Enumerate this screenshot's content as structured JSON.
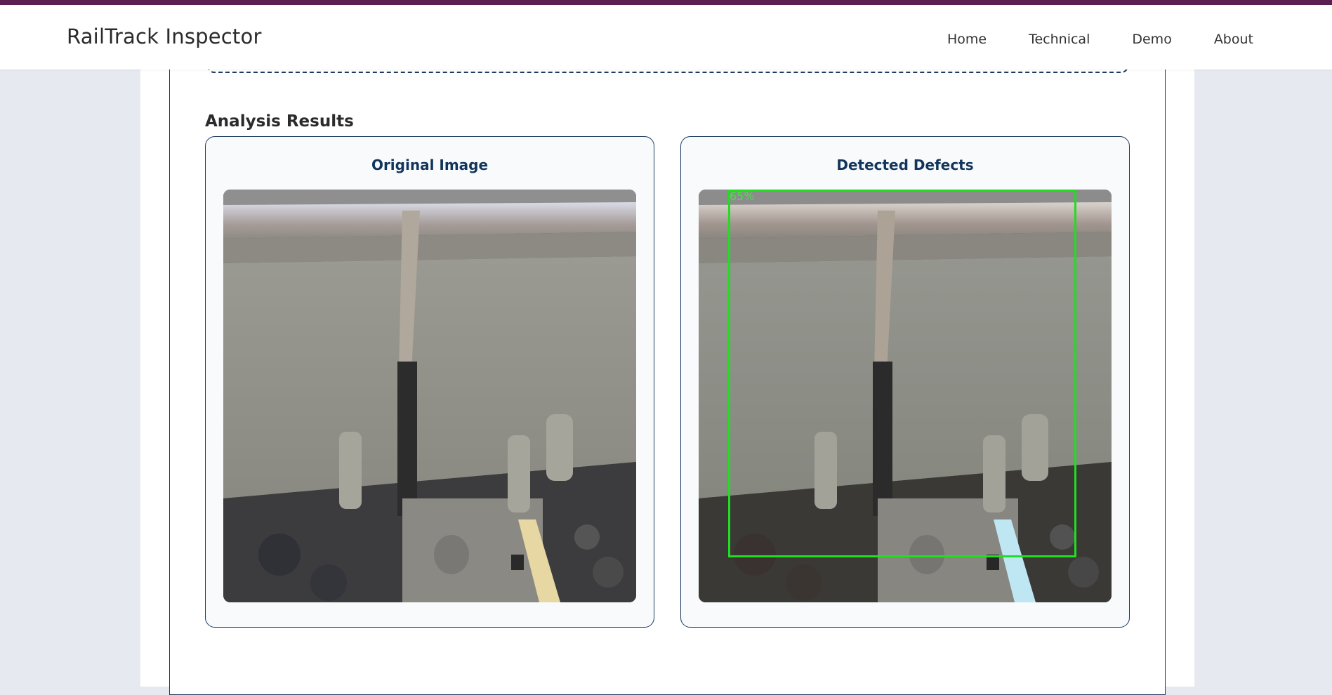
{
  "app": {
    "brand": "RailTrack Inspector"
  },
  "nav": {
    "items": [
      {
        "label": "Home"
      },
      {
        "label": "Technical"
      },
      {
        "label": "Demo"
      },
      {
        "label": "About"
      }
    ]
  },
  "results": {
    "heading": "Analysis Results",
    "original_title": "Original Image",
    "detected_title": "Detected Defects",
    "detection_confidence": "65%"
  },
  "colors": {
    "accent": "#12355b",
    "stripe": "#5c1f52",
    "detection_box": "#22dd22"
  }
}
